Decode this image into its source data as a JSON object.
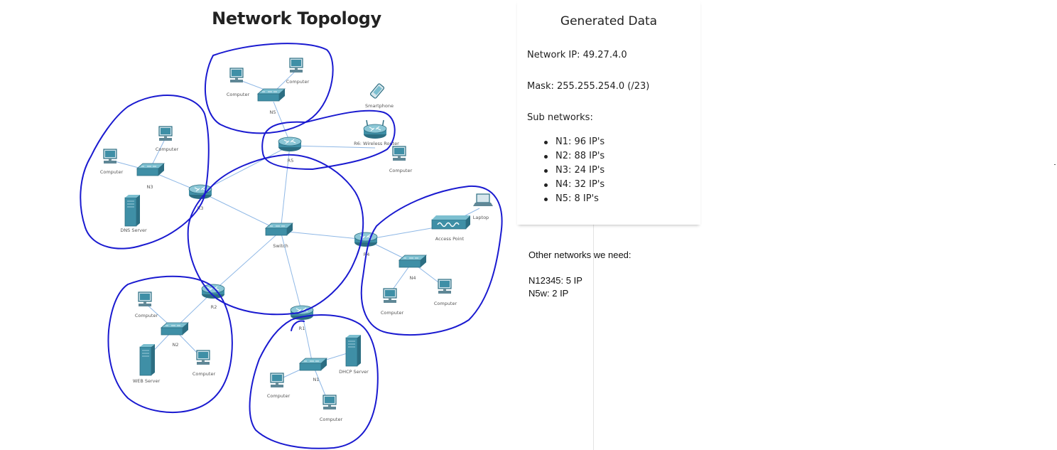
{
  "topology": {
    "title": "Network Topology",
    "labels": {
      "n5_pc1": "Computer",
      "n5_pc2": "Computer",
      "n5_switch": "N5",
      "smartphone": "Smartphone",
      "r6": "R6: Wireless Router",
      "r6_pc": "Computer",
      "r5": "R5",
      "n3_pc1": "Computer",
      "n3_pc2": "Computer",
      "n3_switch": "N3",
      "dns": "DNS Server",
      "r3": "R3",
      "core_switch": "Switch",
      "laptop": "Laptop",
      "access_point": "Access Point",
      "r4": "R4",
      "n4_switch": "N4",
      "n4_pc1": "Computer",
      "n4_pc2": "Computer",
      "r2": "R2",
      "n2_pc1": "Computer",
      "n2_switch": "N2",
      "web": "WEB Server",
      "n2_pc2": "Computer",
      "r1": "R1",
      "n1_switch": "N1",
      "dhcp": "DHCP Server",
      "n1_pc1": "Computer",
      "n1_pc2": "Computer"
    },
    "colors": {
      "annotation": "#1a1ad0",
      "link": "#8fb8e6",
      "device": "#3f8fa6",
      "device_dark": "#2c6e82"
    }
  },
  "generated": {
    "title": "Generated Data",
    "network_ip_label": "Network IP:",
    "network_ip": "49.27.4.0",
    "mask_label": "Mask:",
    "mask": "255.255.254.0 (/23)",
    "subnets_label": "Sub networks:",
    "subnets": [
      "N1: 96 IP's",
      "N2: 88 IP's",
      "N3: 24 IP's",
      "N4: 32 IP's",
      "N5: 8 IP's"
    ]
  },
  "notes": {
    "heading": "Other networks we need:",
    "lines": [
      "N12345: 5 IP",
      "N5w: 2 IP"
    ]
  }
}
